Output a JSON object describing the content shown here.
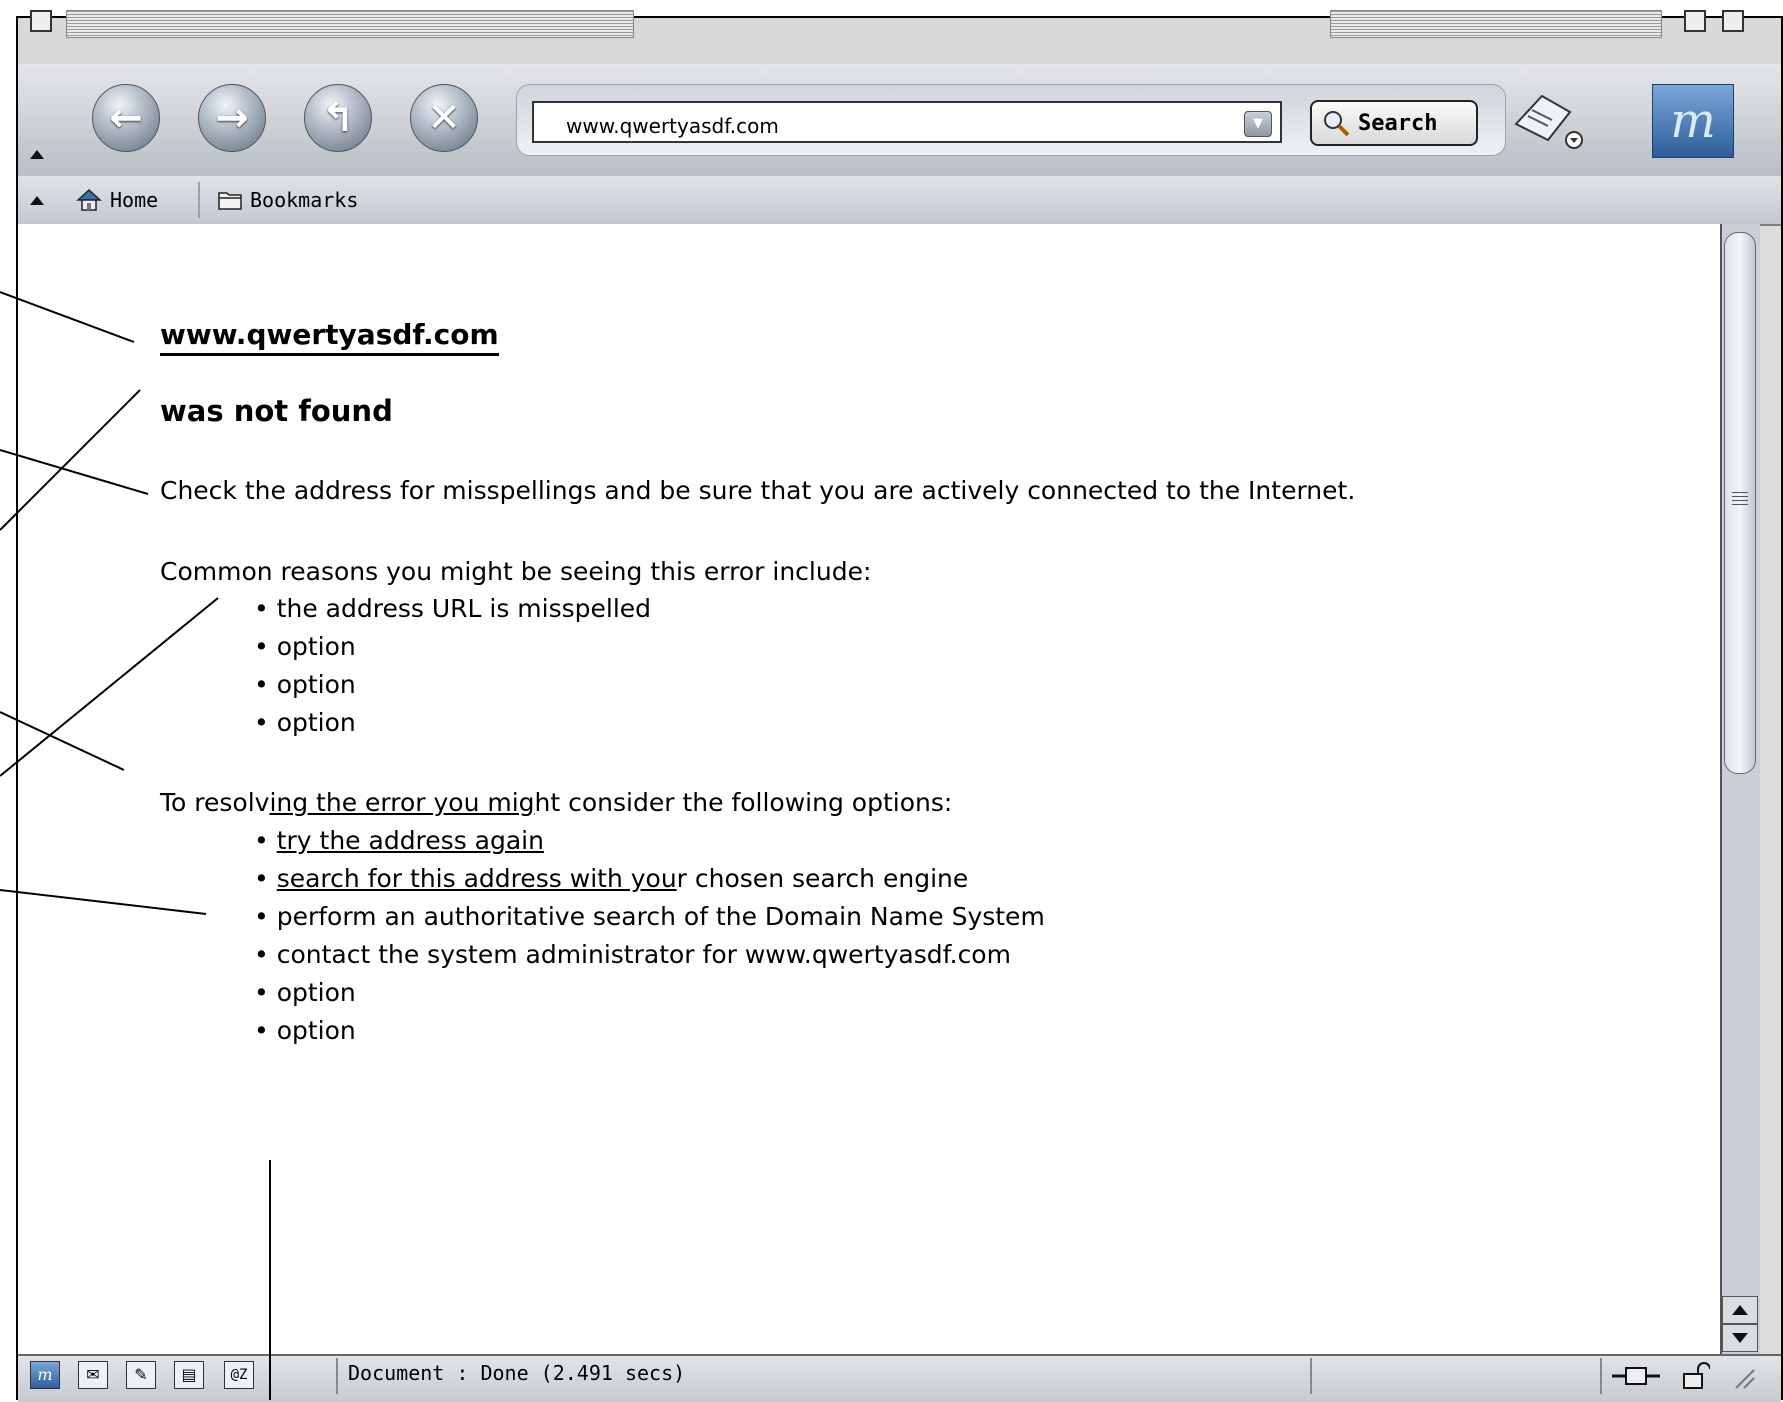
{
  "browser": {
    "url": "www.qwertyasdf.com",
    "search_label": "Search",
    "logo_letter": "m",
    "status_text": "Document : Done (2.491 secs)"
  },
  "bookmark_bar": {
    "home_label": "Home",
    "bookmarks_label": "Bookmarks"
  },
  "page": {
    "heading_url": "www.qwertyasdf.com",
    "heading_not_found": "was not found",
    "check_paragraph": "Check the address for misspellings and be sure that you are actively connected to the Internet.",
    "common_intro": "Common reasons you might be seeing this error include:",
    "common_reasons": [
      "the address URL is misspelled",
      "option",
      "option",
      "option"
    ],
    "resolve_intro_prefix": "To resolv",
    "resolve_intro_underlined": "ing the error you mig",
    "resolve_intro_suffix": "ht consider the following options:",
    "options": [
      {
        "underlined": "try the address again ",
        "rest": ""
      },
      {
        "underlined": "search for this address with you",
        "rest": "r chosen search engine"
      },
      {
        "underlined": "",
        "rest": "perform an authoritative search of the Domain Name System"
      },
      {
        "underlined": "",
        "rest": "contact the system administrator for www.qwertyasdf.com"
      },
      {
        "underlined": "",
        "rest": "option"
      },
      {
        "underlined": "",
        "rest": "option"
      }
    ],
    "bullet": "•"
  },
  "icons": [
    "back-icon",
    "forward-icon",
    "reload-icon",
    "stop-icon",
    "dropdown-icon",
    "magnifier-icon",
    "print-icon",
    "home-icon",
    "folder-icon",
    "mail-icon",
    "composer-icon",
    "address-book-icon",
    "chat-icon",
    "connection-icon",
    "lock-icon",
    "resize-grip-icon"
  ]
}
